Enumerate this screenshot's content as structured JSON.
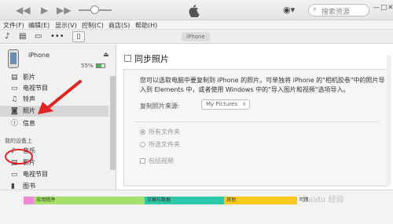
{
  "window": {
    "search_placeholder": "搜索资源",
    "controls": [
      "—",
      "□",
      "✕"
    ]
  },
  "menu": [
    "文件(F)",
    "编辑(E)",
    "显示(V)",
    "控制(C)",
    "商店(S)",
    "帮助(H)"
  ],
  "toolbar": {
    "device_tab": "iPhone"
  },
  "sidebar": {
    "device_name": "iPhone",
    "capacity": "55%",
    "battery_level": 0.55,
    "settings_items": [
      {
        "label": "影片",
        "icon": "film-icon"
      },
      {
        "label": "电视节目",
        "icon": "tv-icon"
      },
      {
        "label": "铃声",
        "icon": "bell-icon"
      },
      {
        "label": "照片",
        "icon": "camera-icon",
        "selected": true
      },
      {
        "label": "信息",
        "icon": "info-icon"
      }
    ],
    "on_device_title": "我的设备上",
    "on_device_items": [
      {
        "label": "音乐",
        "icon": "music-icon"
      },
      {
        "label": "影片",
        "icon": "film-icon"
      },
      {
        "label": "电视节目",
        "icon": "tv-icon"
      },
      {
        "label": "图书",
        "icon": "book-icon"
      }
    ]
  },
  "main": {
    "sync_title": "同步照片",
    "description": "您可以选取电脑中要复制到 iPhone 的照片。可单独将 iPhone 的\"相机胶卷\"中的照片导入到 Elements 中，或者使用 Windows 中的\"导入图片和视频\"选项导入。",
    "source_label": "复制照片来源:",
    "source_value": "My Pictures",
    "option_all": "所有文件夹",
    "option_selected": "所选文件夹",
    "include_videos": "包括视频"
  },
  "storage": {
    "segments": [
      {
        "label": "",
        "color": "#f08bd8",
        "fraction": 0.03
      },
      {
        "label": "应用程序",
        "color": "#a6e06b",
        "fraction": 0.32
      },
      {
        "label": "文稿与数据",
        "color": "#2ec7a8",
        "fraction": 0.23
      },
      {
        "label": "其他",
        "color": "#f7c91d",
        "fraction": 0.21
      },
      {
        "label": "可用",
        "color": "#f4f4f4",
        "fraction": 0.21
      }
    ]
  },
  "watermark": "Baidu 经验"
}
